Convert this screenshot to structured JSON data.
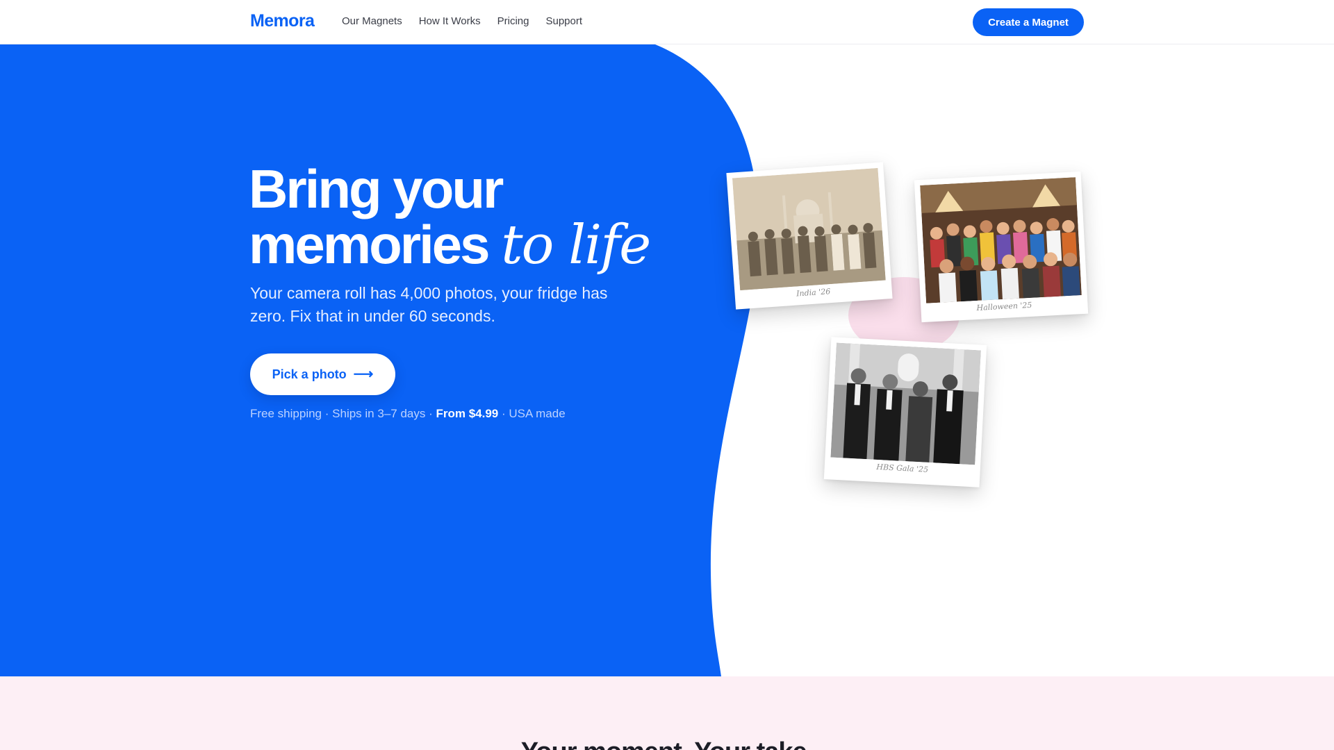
{
  "brand": {
    "name": "Memora",
    "color": "#0a62f5"
  },
  "nav": {
    "items": [
      {
        "label": "Our Magnets"
      },
      {
        "label": "How It Works"
      },
      {
        "label": "Pricing"
      },
      {
        "label": "Support"
      }
    ],
    "cta_label": "Create a Magnet"
  },
  "hero": {
    "title_line1": "Bring your",
    "title_line2_main": "memories",
    "title_line2_accent": "to life",
    "subtitle": "Your camera roll has 4,000 photos, your fridge has zero. Fix that in under 60 seconds.",
    "cta_label": "Pick a photo",
    "cta_icon": "arrow-right-icon",
    "features": {
      "shipping": "Free shipping",
      "sep1": "·",
      "ships": "Ships in 3–7 days",
      "sep2": "·",
      "price": "From $4.99",
      "sep3": "·",
      "made": "USA made"
    },
    "background_color": "#0a62f5"
  },
  "polaroids": [
    {
      "caption": "India '26"
    },
    {
      "caption": "Halloween '25"
    },
    {
      "caption": "HBS Gala '25"
    }
  ],
  "next_section": {
    "heading": "Your moment. Your take.",
    "background_color": "#fdeff5"
  }
}
